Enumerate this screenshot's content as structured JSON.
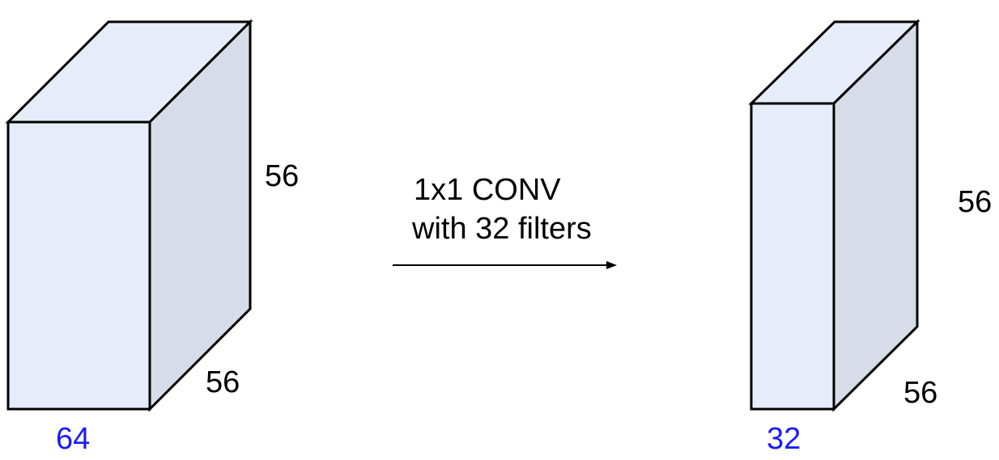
{
  "colors": {
    "front_face": "#e6edf8",
    "top_face": "#e6edf8",
    "side_face": "#d6dce8",
    "edge": "#000000",
    "depth_label": "#1a1aff",
    "text": "#000000",
    "arrow": "#000000"
  },
  "input_volume": {
    "height_label": "56",
    "width_label": "56",
    "depth_label": "64"
  },
  "operation": {
    "line1": "1x1 CONV",
    "line2": "with 32 filters"
  },
  "output_volume": {
    "height_label": "56",
    "width_label": "56",
    "depth_label": "32"
  }
}
